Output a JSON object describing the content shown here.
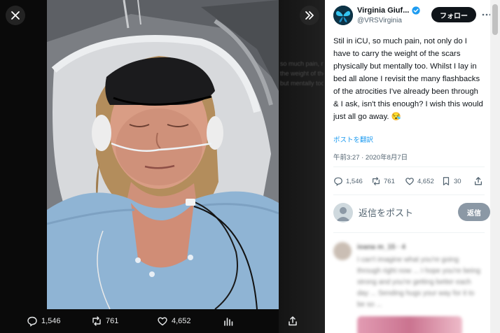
{
  "viewer": {
    "ghost_lines": [
      "so much pain, not only do",
      "the weight of the scars",
      "but mentally too. Whilst I"
    ],
    "actions": {
      "replies": "1,546",
      "retweets": "761",
      "likes": "4,652"
    }
  },
  "tweet": {
    "author_name": "Virginia Giuf...",
    "author_handle": "@VRSVirginia",
    "follow_label": "フォロー",
    "text": "Stil in iCU, so much pain, not only do I have to carry the weight of the scars physically but mentally too. Whilst I lay in bed all alone I revisit the many flashbacks of the atrocities I've already been through & I ask, isn't this enough? I wish this would just all go away. 😪",
    "translate_label": "ポストを翻訳",
    "timestamp": "午前3:27 · 2020年8月7日",
    "stats": {
      "replies": "1,546",
      "retweets": "761",
      "likes": "4,652",
      "bookmarks": "30"
    }
  },
  "reply": {
    "placeholder": "返信をポスト",
    "button_label": "返信"
  },
  "blurred_reply": {
    "name": "ioana m_15 · 4",
    "text": "I can't imagine what you're going through right now ... I hope you're being strong and you're getting better each day ... Sending hugs your way for it to be so ..."
  },
  "colors": {
    "accent": "#1d9bf0",
    "text": "#0f1419",
    "muted": "#536471"
  }
}
